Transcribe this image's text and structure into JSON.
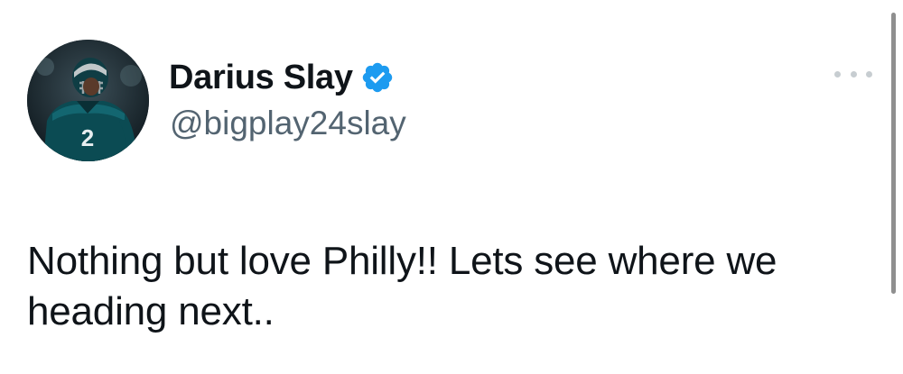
{
  "tweet": {
    "author": {
      "display_name": "Darius Slay",
      "handle": "@bigplay24slay",
      "verified": true,
      "avatar_jersey_number": "2"
    },
    "text": "Nothing but love Philly!! Lets see where we heading next..",
    "more_menu_icon": "more-horizontal-icon"
  },
  "colors": {
    "text_primary": "#0f1419",
    "text_secondary": "#536471",
    "verified_blue": "#1d9bf0",
    "eagles_green": "#0b4b53"
  }
}
